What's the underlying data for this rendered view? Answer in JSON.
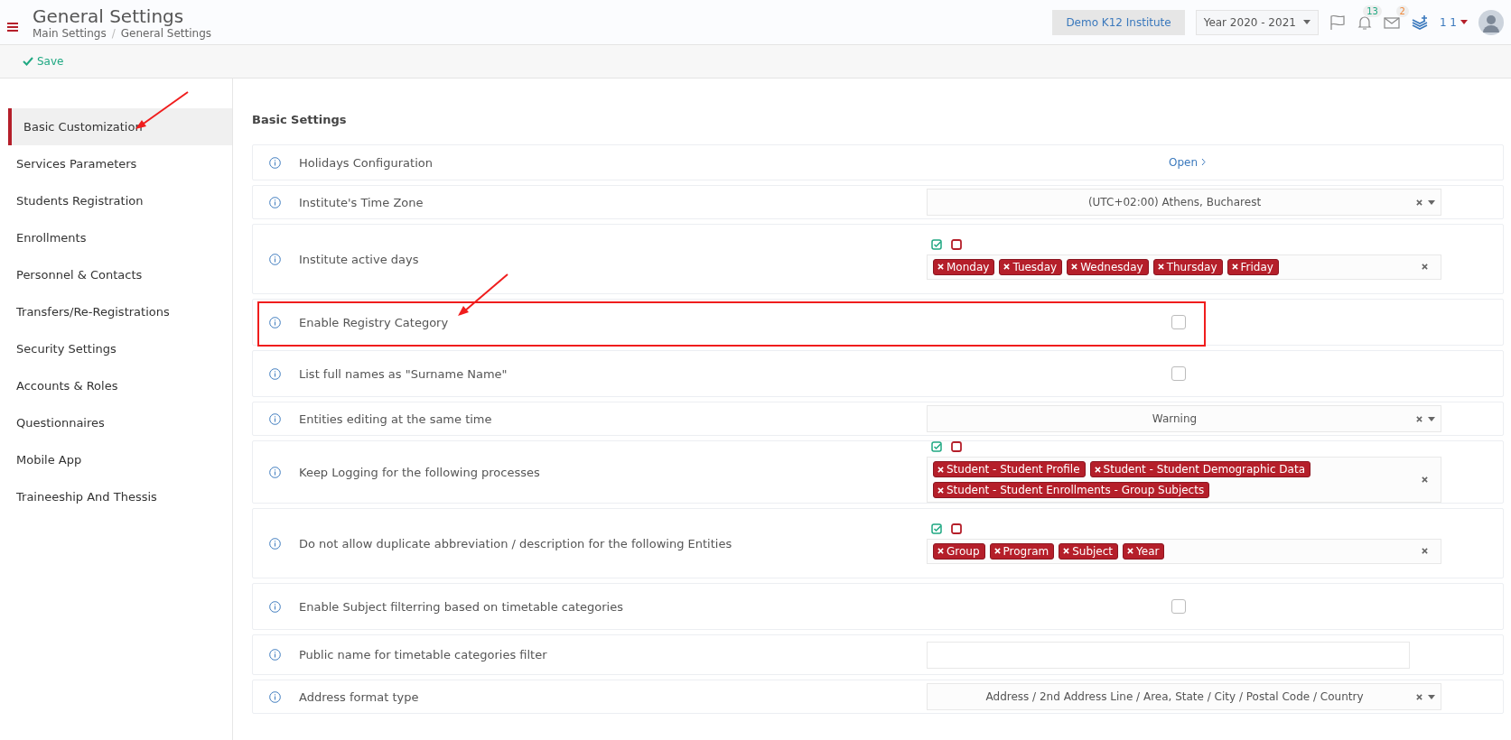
{
  "header": {
    "title": "General Settings",
    "breadcrumb": [
      "Main Settings",
      "General Settings"
    ],
    "breadcrumb_separator": "/",
    "institute": "Demo K12 Institute",
    "year": "Year 2020 - 2021",
    "notifications": "13",
    "messages": "2",
    "user": "1 1"
  },
  "toolbar": {
    "save": "Save"
  },
  "sidebar": {
    "items": [
      {
        "label": "Basic Customization",
        "selected": true
      },
      {
        "label": "Services Parameters",
        "selected": false
      },
      {
        "label": "Students Registration",
        "selected": false
      },
      {
        "label": "Enrollments",
        "selected": false
      },
      {
        "label": "Personnel & Contacts",
        "selected": false
      },
      {
        "label": "Transfers/Re-Registrations",
        "selected": false
      },
      {
        "label": "Security Settings",
        "selected": false
      },
      {
        "label": "Accounts & Roles",
        "selected": false
      },
      {
        "label": "Questionnaires",
        "selected": false
      },
      {
        "label": "Mobile App",
        "selected": false
      },
      {
        "label": "Traineeship And Thessis",
        "selected": false
      }
    ]
  },
  "section": {
    "title": "Basic Settings"
  },
  "settings": [
    {
      "kind": "link",
      "label": "Holidays Configuration",
      "value": "Open",
      "highlighted": false
    },
    {
      "kind": "select",
      "label": "Institute's Time Zone",
      "value": "(UTC+02:00) Athens, Bucharest",
      "highlighted": false
    },
    {
      "kind": "tags",
      "label": "Institute active days",
      "tags": [
        "Monday",
        "Tuesday",
        "Wednesday",
        "Thursday",
        "Friday"
      ],
      "highlighted": false
    },
    {
      "kind": "checkbox",
      "label": "Enable Registry Category",
      "checked": false,
      "highlighted": true
    },
    {
      "kind": "checkbox",
      "label": "List full names as \"Surname Name\"",
      "checked": false,
      "highlighted": false
    },
    {
      "kind": "select",
      "label": "Entities editing at the same time",
      "value": "Warning",
      "highlighted": false
    },
    {
      "kind": "tags",
      "label": "Keep Logging for the following processes",
      "tags": [
        "Student - Student Profile",
        "Student - Student Demographic Data",
        "Student - Student Enrollments - Group Subjects"
      ],
      "highlighted": false
    },
    {
      "kind": "tags",
      "label": "Do not allow duplicate abbreviation / description for the following Entities",
      "tags": [
        "Group",
        "Program",
        "Subject",
        "Year"
      ],
      "highlighted": false
    },
    {
      "kind": "checkbox",
      "label": "Enable Subject filterring based on timetable categories",
      "checked": false,
      "highlighted": false
    },
    {
      "kind": "text",
      "label": "Public name for timetable categories filter",
      "highlighted": false
    },
    {
      "kind": "select",
      "label": "Address format type",
      "value": "Address / 2nd Address Line / Area, State / City / Postal Code / Country",
      "highlighted": false
    }
  ]
}
